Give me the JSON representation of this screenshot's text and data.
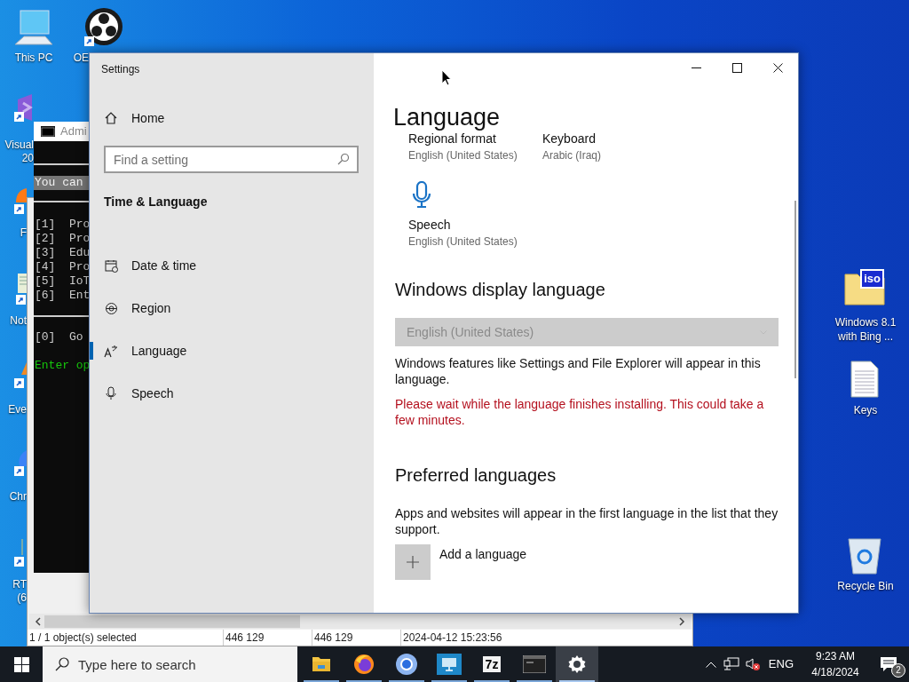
{
  "desktop": {
    "left_icons": [
      {
        "kind": "pc",
        "lines": [
          "This PC"
        ]
      },
      {
        "kind": "obs",
        "lines": [
          "OE"
        ]
      },
      {
        "kind": "vs",
        "lines": [
          "Visual",
          "20"
        ]
      },
      {
        "kind": "firefox",
        "lines": [
          "F"
        ]
      },
      {
        "kind": "notepad",
        "lines": [
          "Not"
        ]
      },
      {
        "kind": "event",
        "lines": [
          "Eve"
        ]
      },
      {
        "kind": "chrome",
        "lines": [
          "Chr"
        ]
      },
      {
        "kind": "rt",
        "lines": [
          "RT",
          "(6"
        ]
      }
    ],
    "right_icons": [
      {
        "kind": "iso",
        "badge": "iso",
        "lines": [
          "Windows 8.1",
          "with Bing ..."
        ]
      },
      {
        "kind": "text",
        "lines": [
          "Keys"
        ]
      },
      {
        "kind": "recycle",
        "lines": [
          "Recycle Bin"
        ]
      }
    ]
  },
  "console": {
    "title": "Admi",
    "banner": "You can",
    "options": [
      "[1]  Pro",
      "[2]  Pro",
      "[3]  Edu",
      "[4]  Pro",
      "[5]  IoT",
      "[6]  Ent"
    ],
    "back": "[0]  Go",
    "prompt": "Enter op"
  },
  "explorer": {
    "status": [
      "1 / 1 object(s) selected",
      "446 129",
      "446 129",
      "2024-04-12 15:23:56"
    ]
  },
  "settings": {
    "title": "Settings",
    "home": "Home",
    "search_placeholder": "Find a setting",
    "section": "Time & Language",
    "nav": [
      {
        "kind": "calendar",
        "label": "Date & time",
        "selected": false
      },
      {
        "kind": "globe",
        "label": "Region",
        "selected": false
      },
      {
        "kind": "language",
        "label": "Language",
        "selected": true
      },
      {
        "kind": "mic",
        "label": "Speech",
        "selected": false
      }
    ],
    "page_title": "Language",
    "tiles": [
      {
        "kind": "plain",
        "label": "Regional format",
        "value": "English (United States)"
      },
      {
        "kind": "plain",
        "label": "Keyboard",
        "value": "Arabic (Iraq)"
      },
      {
        "kind": "mic",
        "label": "Speech",
        "value": "English (United States)"
      }
    ],
    "display_heading": "Windows display language",
    "display_dropdown": {
      "value": "English (United States)",
      "disabled": true
    },
    "display_note": "Windows features like Settings and File Explorer will appear in this language.",
    "warning": "Please wait while the language finishes installing. This could take a few minutes.",
    "preferred_heading": "Preferred languages",
    "preferred_note": "Apps and websites will appear in the first language in the list that they support.",
    "add_button": "Add a language"
  },
  "taskbar": {
    "search_placeholder": "Type here to search",
    "apps": [
      {
        "kind": "explorer",
        "selected": false
      },
      {
        "kind": "firefox",
        "selected": false
      },
      {
        "kind": "chrome",
        "selected": false
      },
      {
        "kind": "remote",
        "selected": false
      },
      {
        "kind": "archiver",
        "label": "7z",
        "selected": false
      },
      {
        "kind": "console",
        "selected": false
      },
      {
        "kind": "settings",
        "selected": true
      }
    ],
    "language": "ENG",
    "time": "9:23 AM",
    "date": "4/18/2024",
    "notifications": "2"
  }
}
